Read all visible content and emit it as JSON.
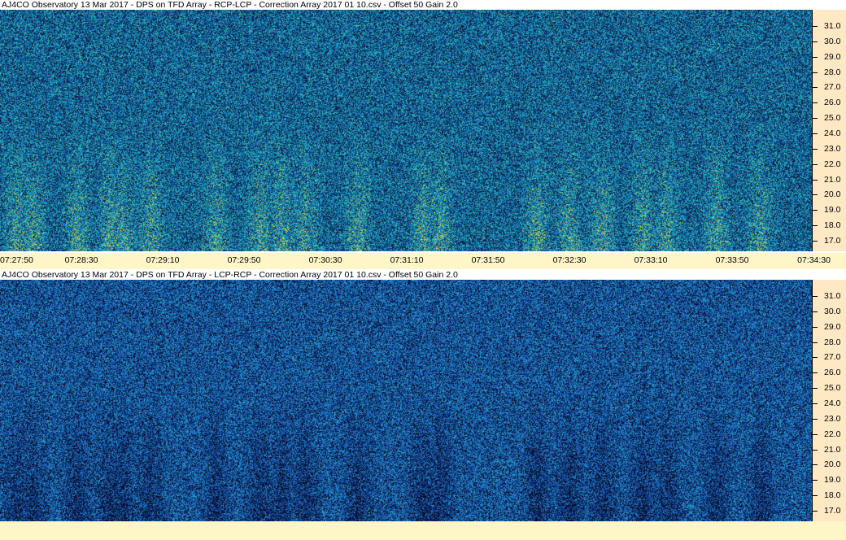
{
  "panels": [
    {
      "title": "AJ4CO Observatory 13 Mar 2017  -  DPS on TFD Array  -  RCP-LCP  -  Correction Array 2017 01 10.csv  -  Offset 50  Gain 2.0",
      "palette": "bright",
      "y_ticks": [
        "31.0",
        "30.0",
        "29.0",
        "28.0",
        "27.0",
        "26.0",
        "25.0",
        "24.0",
        "23.0",
        "22.0",
        "21.0",
        "20.0",
        "19.0",
        "18.0",
        "17.0"
      ]
    },
    {
      "title": "AJ4CO Observatory 13 Mar 2017  -  DPS on TFD Array  -  LCP-RCP  -  Correction Array 2017 01 10.csv  -  Offset 50  Gain 2.0",
      "palette": "dark",
      "y_ticks": [
        "31.0",
        "30.0",
        "29.0",
        "28.0",
        "27.0",
        "26.0",
        "25.0",
        "24.0",
        "23.0",
        "22.0",
        "21.0",
        "20.0",
        "19.0",
        "18.0",
        "17.0"
      ]
    }
  ],
  "x_ticks": [
    "07:27:50",
    "07:28:30",
    "07:29:10",
    "07:29:50",
    "07:30:30",
    "07:31:10",
    "07:31:50",
    "07:32:30",
    "07:33:10",
    "07:33:50",
    "07:34:30"
  ],
  "colors": {
    "axis_bg": "#ffe8c4",
    "time_bar_bg": "#fff6c8"
  }
}
